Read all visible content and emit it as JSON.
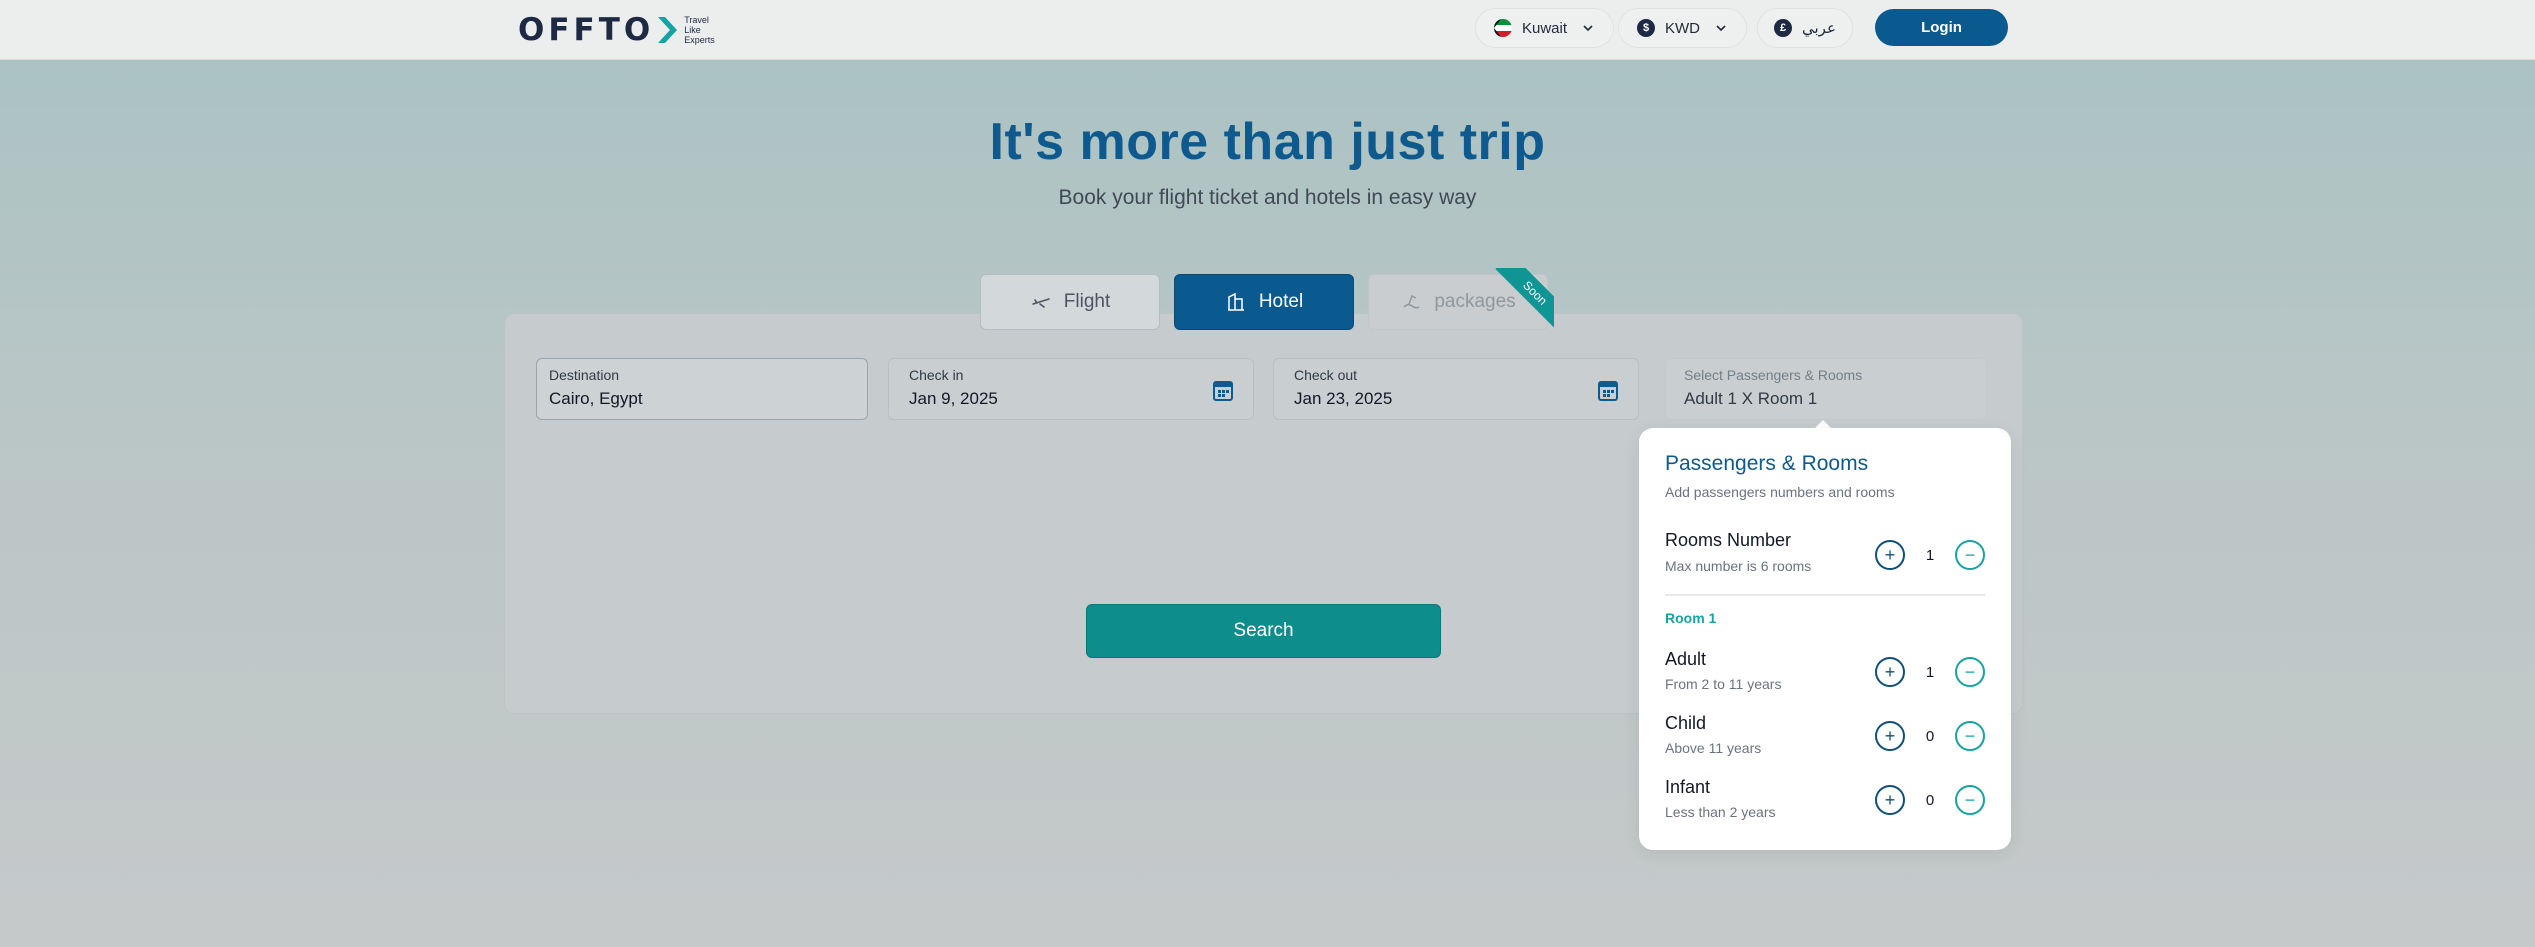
{
  "header": {
    "logo_text": "OFFTO",
    "logo_tagline": [
      "Travel",
      "Like",
      "Experts"
    ],
    "country": "Kuwait",
    "currency": "KWD",
    "currency_symbol": "$",
    "language": "عربي",
    "language_symbol": "£",
    "login_label": "Login"
  },
  "hero": {
    "title": "It's more than just trip",
    "subtitle": "Book your flight ticket and hotels in easy way"
  },
  "tabs": [
    {
      "label": "Flight",
      "icon": "plane-icon",
      "state": "inactive"
    },
    {
      "label": "Hotel",
      "icon": "building-icon",
      "state": "active"
    },
    {
      "label": "packages",
      "icon": "package-icon",
      "state": "disabled",
      "badge": "Soon"
    }
  ],
  "search": {
    "destination_label": "Destination",
    "destination_value": "Cairo, Egypt",
    "checkin_label": "Check in",
    "checkin_value": "Jan 9, 2025",
    "checkout_label": "Check out",
    "checkout_value": "Jan 23, 2025",
    "pax_label": "Select Passengers & Rooms",
    "pax_value": "Adult 1  X Room 1",
    "search_label": "Search"
  },
  "popup": {
    "title": "Passengers & Rooms",
    "subtitle": "Add passengers numbers and rooms",
    "rooms": {
      "title": "Rooms Number",
      "sub": "Max number is 6 rooms",
      "count": "1"
    },
    "room_label": "Room 1",
    "adult": {
      "title": "Adult",
      "sub": "From 2 to 11 years",
      "count": "1"
    },
    "child": {
      "title": "Child",
      "sub": "Above 11 years",
      "count": "0"
    },
    "infant": {
      "title": "Infant",
      "sub": "Less than 2 years",
      "count": "0"
    },
    "plus_symbol": "+",
    "minus_symbol": "−"
  },
  "colors": {
    "brand_blue": "#0a5a8f",
    "accent_teal": "#0e8d8d"
  }
}
